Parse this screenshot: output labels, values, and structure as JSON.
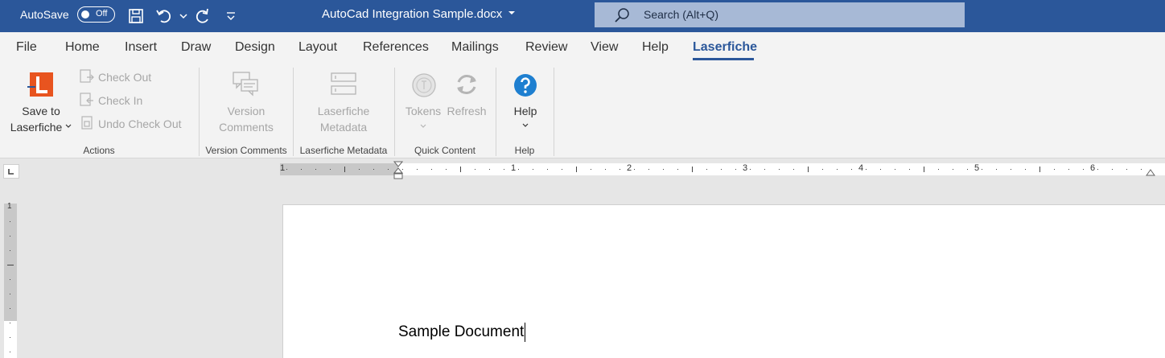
{
  "titlebar": {
    "autosave_label": "AutoSave",
    "autosave_state": "Off",
    "doc_title": "AutoCad Integration Sample.docx",
    "search_placeholder": "Search (Alt+Q)"
  },
  "tabs": [
    "File",
    "Home",
    "Insert",
    "Draw",
    "Design",
    "Layout",
    "References",
    "Mailings",
    "Review",
    "View",
    "Help",
    "Laserfiche"
  ],
  "ribbon": {
    "actions": {
      "save_line1": "Save to",
      "save_line2": "Laserfiche",
      "check_out": "Check Out",
      "check_in": "Check In",
      "undo_check_out": "Undo Check Out",
      "group_label": "Actions"
    },
    "version_comments": {
      "line1": "Version",
      "line2": "Comments",
      "group_label": "Version Comments"
    },
    "laserfiche_metadata": {
      "line1": "Laserfiche",
      "line2": "Metadata",
      "group_label": "Laserfiche Metadata"
    },
    "quick_content": {
      "tokens": "Tokens",
      "refresh": "Refresh",
      "group_label": "Quick Content"
    },
    "help": {
      "label": "Help",
      "group_label": "Help"
    }
  },
  "ruler": {
    "numbers": [
      "1",
      "1",
      "2",
      "3",
      "4",
      "5",
      "6"
    ],
    "vertical_number": "1"
  },
  "document": {
    "text": "Sample Document"
  },
  "colors": {
    "accent": "#2b579a",
    "laserfiche_orange": "#e8541f",
    "help_blue": "#1e7fd0"
  }
}
